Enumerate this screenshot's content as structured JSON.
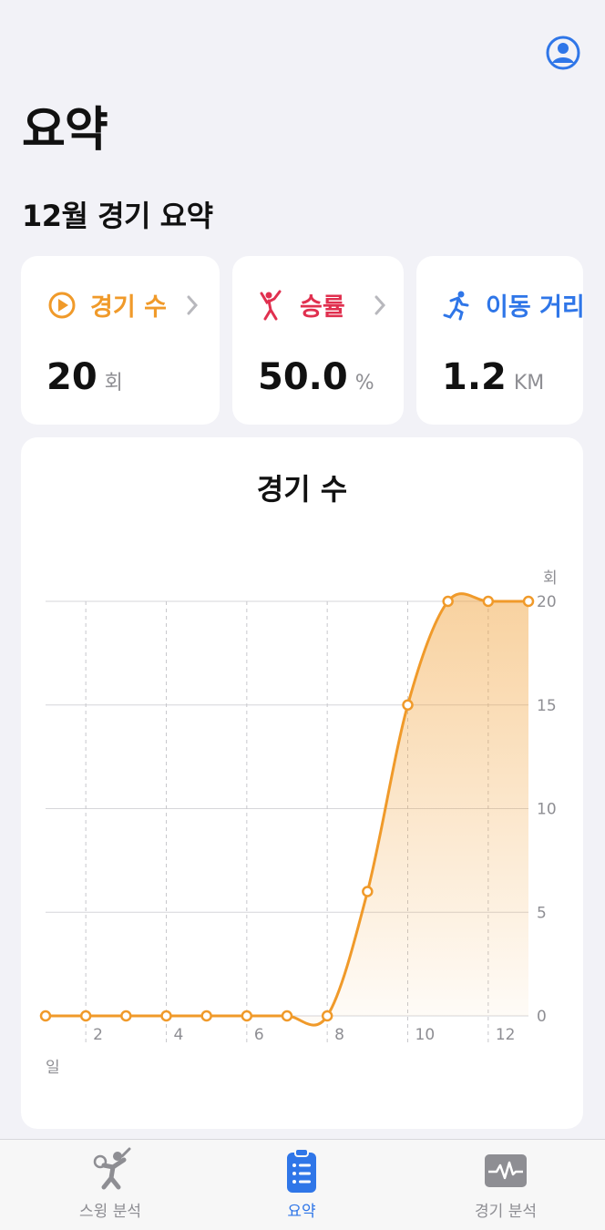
{
  "header": {
    "title": "요약",
    "section_title": "12월 경기 요약"
  },
  "cards": [
    {
      "label": "경기 수",
      "value": "20",
      "unit": "회",
      "color": "#f09a2a",
      "icon": "play-circle-icon"
    },
    {
      "label": "승률",
      "value": "50.0",
      "unit": "%",
      "color": "#e0304f",
      "icon": "celebrating-person-icon"
    },
    {
      "label": "이동 거리",
      "value": "1.2",
      "unit": "KM",
      "color": "#2f76e8",
      "icon": "running-person-icon"
    }
  ],
  "chart": {
    "title": "경기 수",
    "y_unit": "회",
    "x_unit": "일"
  },
  "chart_data": {
    "type": "area",
    "title": "경기 수",
    "xlabel": "일",
    "ylabel": "회",
    "x": [
      1,
      2,
      3,
      4,
      5,
      6,
      7,
      8,
      9,
      10,
      11,
      12,
      13
    ],
    "values": [
      0,
      0,
      0,
      0,
      0,
      0,
      0,
      0,
      6,
      15,
      20,
      20,
      20
    ],
    "x_ticks": [
      2,
      4,
      6,
      8,
      10,
      12
    ],
    "y_ticks": [
      0,
      5,
      10,
      15,
      20
    ],
    "xlim": [
      1,
      13
    ],
    "ylim": [
      0,
      20
    ],
    "color": "#f09a2a",
    "grid": true
  },
  "tabbar": {
    "tabs": [
      {
        "label": "스윙 분석",
        "icon": "swing-player-icon",
        "active": false
      },
      {
        "label": "요약",
        "icon": "clipboard-list-icon",
        "active": true
      },
      {
        "label": "경기 분석",
        "icon": "waveform-monitor-icon",
        "active": false
      }
    ]
  },
  "colors": {
    "accent": "#2f76e8",
    "orange": "#f09a2a",
    "red": "#e0304f",
    "background": "#f2f2f7"
  }
}
